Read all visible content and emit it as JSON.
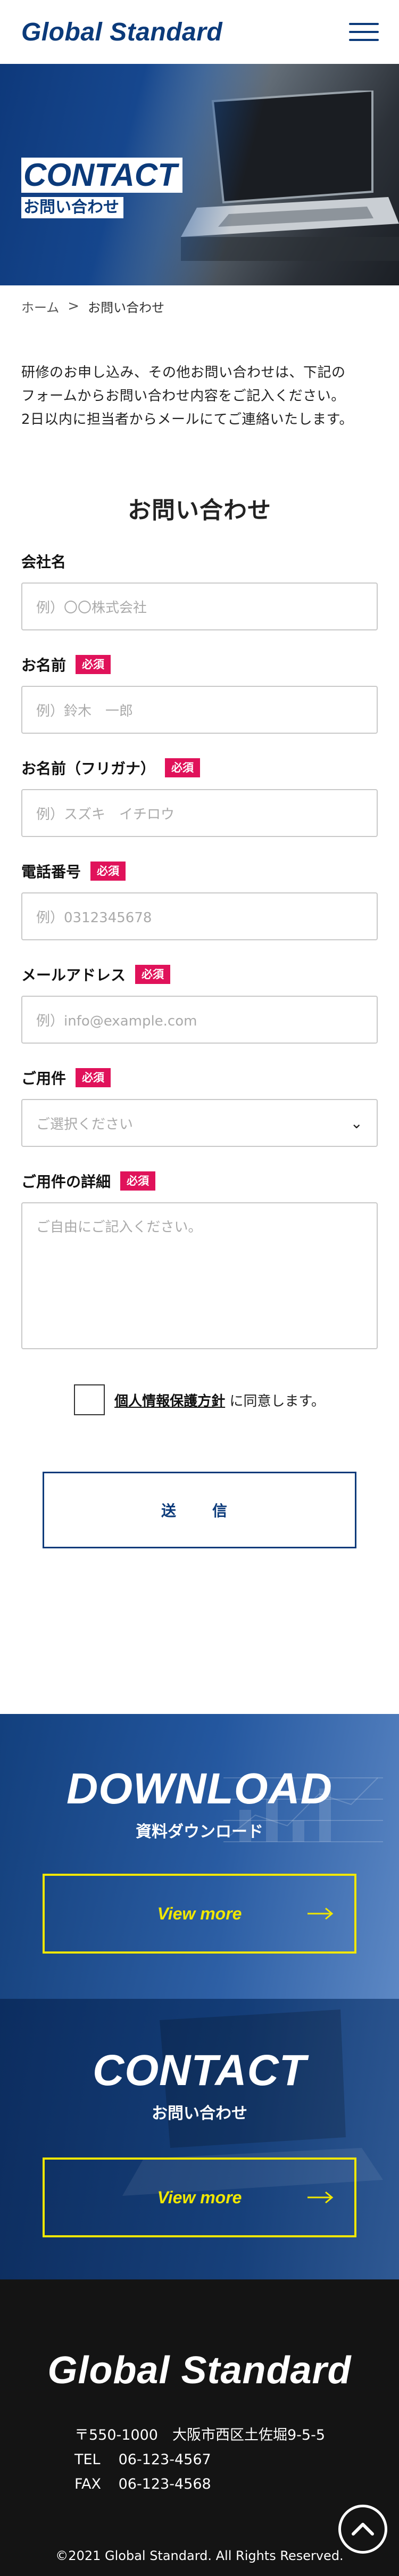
{
  "header": {
    "logo": "Global Standard"
  },
  "hero": {
    "title": "CONTACT",
    "subtitle": "お問い合わせ"
  },
  "breadcrumb": {
    "home": "ホーム",
    "separator": ">",
    "current": "お問い合わせ"
  },
  "intro": {
    "line1": "研修のお申し込み、その他お問い合わせは、下記の",
    "line2": "フォームからお問い合わせ内容をご記入ください。",
    "line3": "2日以内に担当者からメールにてご連絡いたします。"
  },
  "form": {
    "title": "お問い合わせ",
    "required_badge": "必須",
    "company": {
      "label": "会社名",
      "placeholder": "例）〇〇株式会社"
    },
    "name": {
      "label": "お名前",
      "placeholder": "例）鈴木　一郎"
    },
    "kana": {
      "label": "お名前（フリガナ）",
      "placeholder": "例）スズキ　イチロウ"
    },
    "phone": {
      "label": "電話番号",
      "placeholder": "例）0312345678"
    },
    "email": {
      "label": "メールアドレス",
      "placeholder": "例）info@example.com"
    },
    "subject": {
      "label": "ご用件",
      "selected": "ご選択ください"
    },
    "details": {
      "label": "ご用件の詳細",
      "placeholder": "ご自由にご記入ください。"
    },
    "privacy_link": "個人情報保護方針",
    "privacy_suffix": "に同意します。",
    "submit": "送　信"
  },
  "download": {
    "title": "DOWNLOAD",
    "subtitle": "資料ダウンロード",
    "button": "View more"
  },
  "contact_banner": {
    "title": "CONTACT",
    "subtitle": "お問い合わせ",
    "button": "View more"
  },
  "footer": {
    "logo": "Global Standard",
    "address": "〒550-1000　大阪市西区土佐堀9-5-5",
    "tel_label": "TEL",
    "tel": "06-123-4567",
    "fax_label": "FAX",
    "fax": "06-123-4568",
    "copyright": "©2021 Global Standard. All Rights Reserved."
  },
  "colors": {
    "brand": "#0b3a7a",
    "required": "#e0125a",
    "accent_yellow": "#f1e700",
    "footer_bg": "#141414"
  },
  "icons": [
    "hamburger-menu-icon",
    "chevron-down-icon",
    "arrow-right-icon",
    "back-to-top-icon"
  ]
}
